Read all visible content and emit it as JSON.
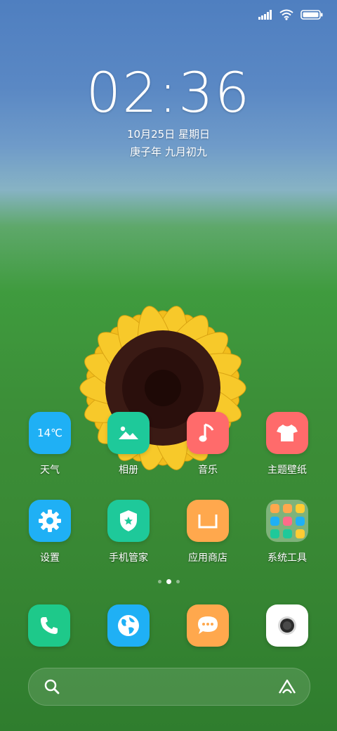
{
  "status_bar": {
    "signal": "signal-icon",
    "wifi": "wifi-icon",
    "battery": "battery-icon"
  },
  "clock": {
    "time": "02:36",
    "date": "10月25日 星期日",
    "lunar": "庚子年 九月初九"
  },
  "apps": [
    {
      "label": "天气",
      "name": "weather",
      "icon_text": "14℃",
      "color": "#1fb0f5"
    },
    {
      "label": "相册",
      "name": "gallery",
      "color": "#1ec99a"
    },
    {
      "label": "音乐",
      "name": "music",
      "color": "#ff6b6b"
    },
    {
      "label": "主题壁纸",
      "name": "themes",
      "color": "#ff6b6b"
    },
    {
      "label": "设置",
      "name": "settings",
      "color": "#1fb0f5"
    },
    {
      "label": "手机管家",
      "name": "security",
      "color": "#1ec99a"
    },
    {
      "label": "应用商店",
      "name": "app-store",
      "color": "#ffa84d"
    },
    {
      "label": "系统工具",
      "name": "system-tools-folder"
    }
  ],
  "dock": [
    {
      "name": "phone",
      "icon": "phone-icon",
      "color": "#1ec98a"
    },
    {
      "name": "browser",
      "icon": "globe-icon",
      "color": "#1fb0f5"
    },
    {
      "name": "messages",
      "icon": "chat-icon",
      "color": "#ffa84d"
    },
    {
      "name": "camera",
      "icon": "camera-icon",
      "color": "#ffffff"
    }
  ],
  "pages": {
    "count": 3,
    "active": 1
  },
  "search": {
    "left_icon": "search-icon",
    "right_icon": "assistant-icon"
  }
}
